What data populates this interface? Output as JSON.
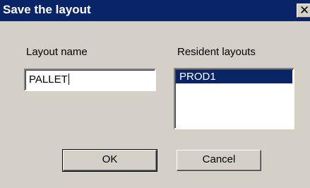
{
  "window": {
    "title": "Save the layout",
    "close_glyph": "✕"
  },
  "form": {
    "layout_name_label": "Layout name",
    "layout_name_value": "PALLET",
    "resident_layouts_label": "Resident layouts",
    "resident_layouts": [
      "PROD1"
    ],
    "selected_layout": "PROD1"
  },
  "buttons": {
    "ok_label": "OK",
    "cancel_label": "Cancel"
  },
  "colors": {
    "titlebar": "#0a2468",
    "dialog_bg": "#d4d0c8",
    "selection": "#0a2468"
  }
}
